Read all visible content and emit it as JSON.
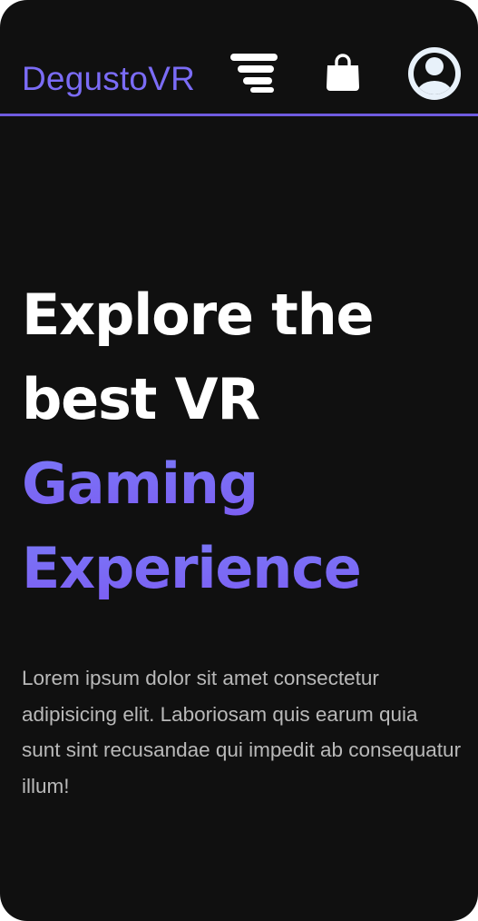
{
  "header": {
    "brand": "DegustoVR",
    "icons": [
      "menu-icon",
      "shopping-bag-icon",
      "user-profile-icon"
    ]
  },
  "hero": {
    "line1": "Explore the",
    "line2": "best VR",
    "line3": "Gaming",
    "line4": "Experience",
    "description": "Lorem ipsum dolor sit amet consectetur adipisicing elit. Laboriosam quis earum quia sunt sint recusandae qui impedit ab consequatur illum!"
  },
  "colors": {
    "background": "#101010",
    "accent": "#7B6CF6",
    "divider": "#6F5BE0",
    "gradient_start": "#7A7BF8",
    "gradient_end": "#7C5CF2",
    "headline": "#FFFFFF",
    "body_text": "#B9B9B9",
    "profile_circle": "#E8F1FA"
  }
}
